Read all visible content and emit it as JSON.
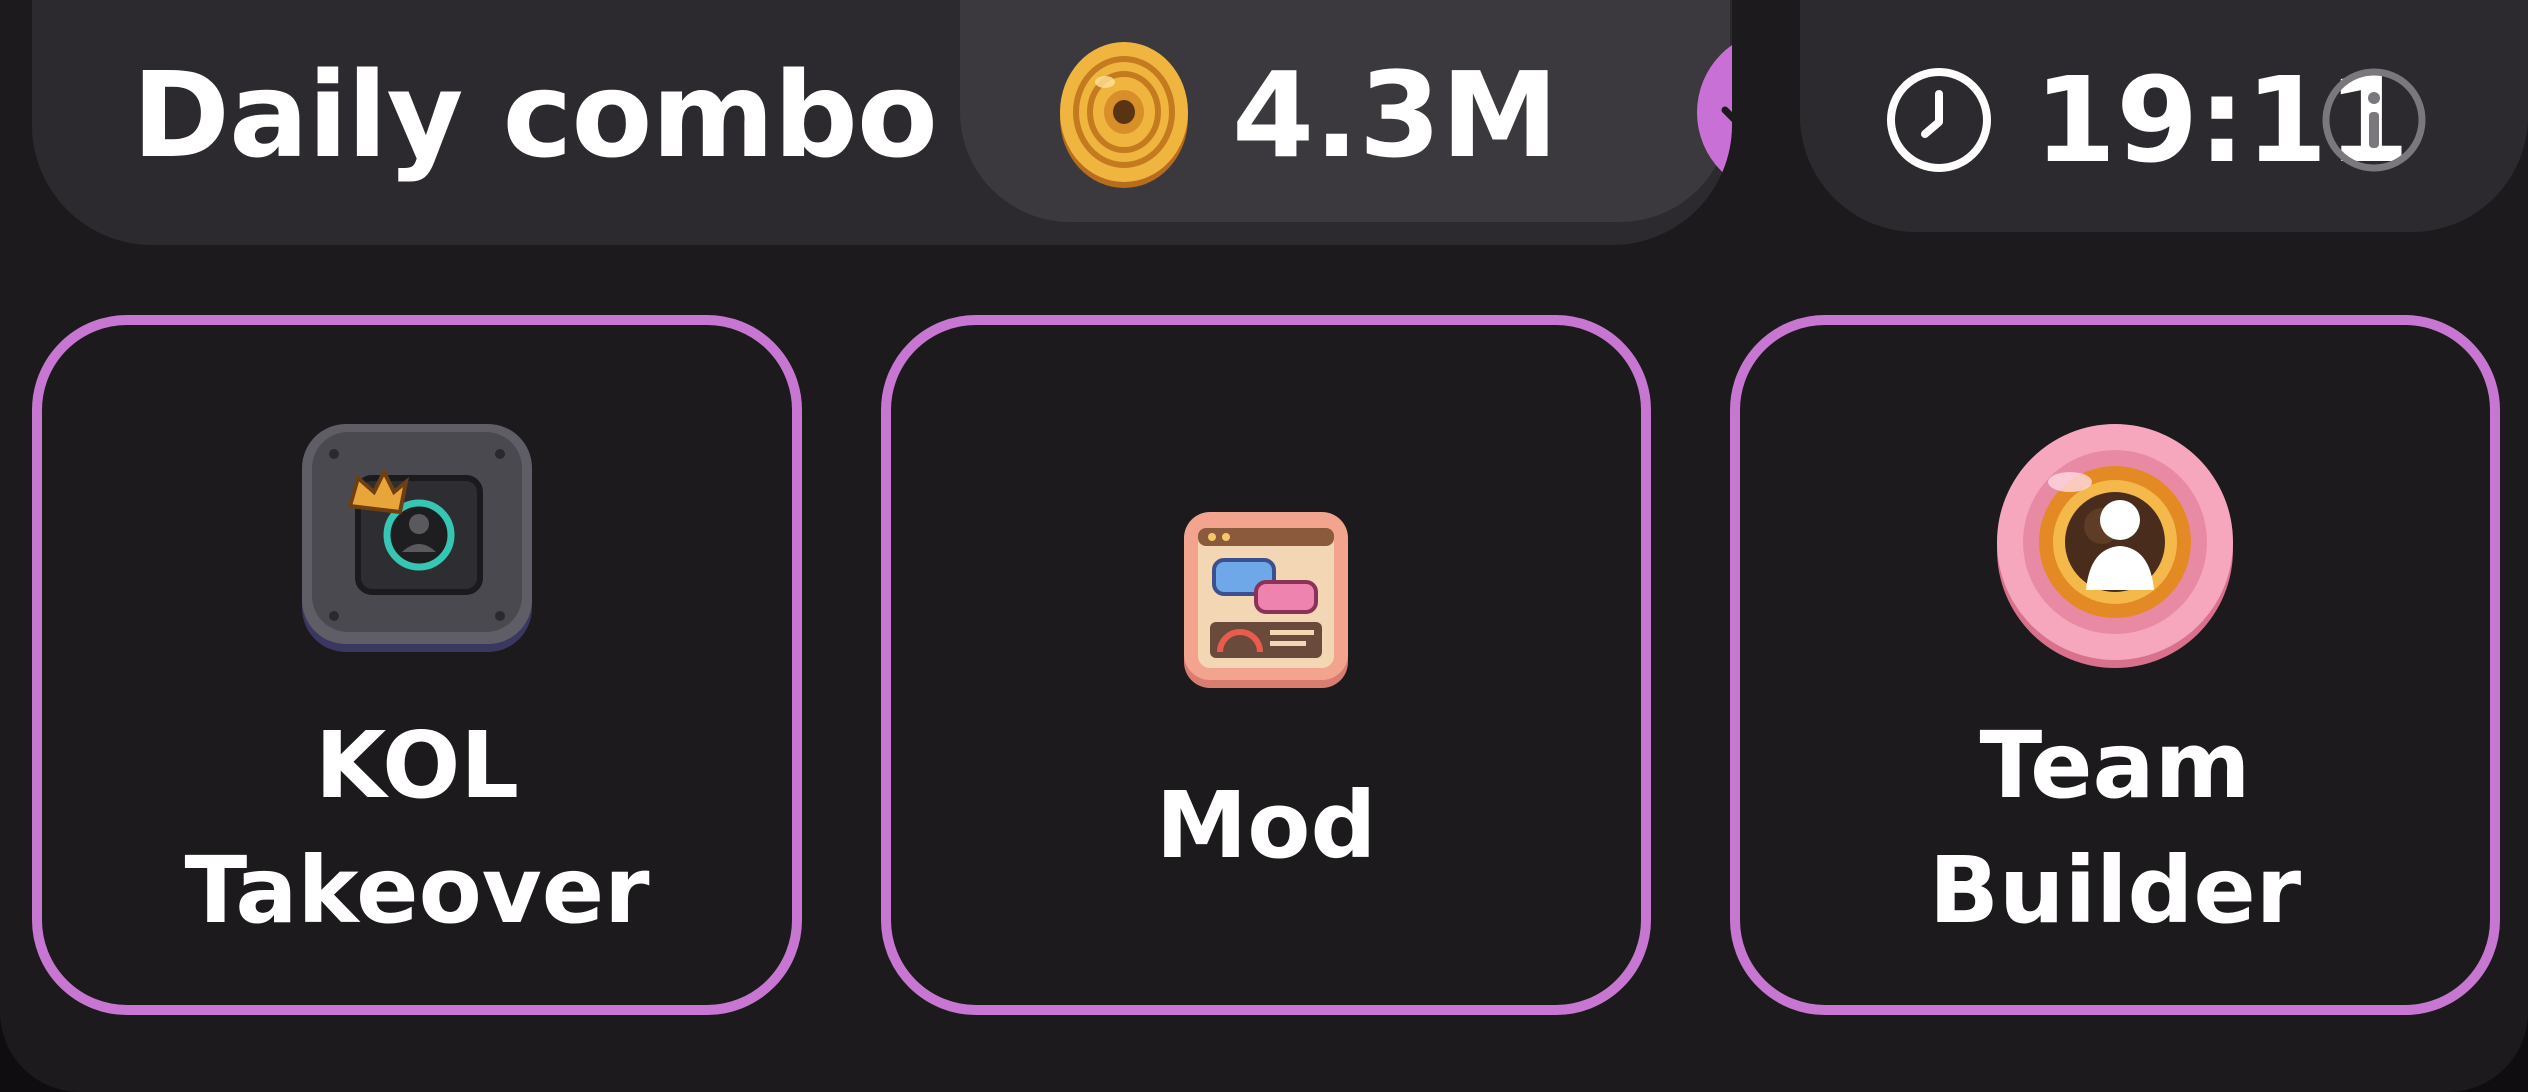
{
  "header": {
    "title": "Daily combo",
    "reward": {
      "value": "4.3M",
      "icon": "coin-icon"
    },
    "timer": {
      "value": "19:11",
      "icon": "clock-icon"
    },
    "info_icon": "info-icon"
  },
  "cards": [
    {
      "line1": "KOL",
      "line2": "Takeover",
      "icon": "kol-takeover-icon"
    },
    {
      "line1": "Mod",
      "line2": "",
      "icon": "mod-icon"
    },
    {
      "line1": "Team",
      "line2": "Builder",
      "icon": "team-builder-icon"
    }
  ],
  "colors": {
    "accent": "#c777d2",
    "panel": "#1c1a1d",
    "pill": "#2c2a2e",
    "coin": "#e9a93b"
  }
}
